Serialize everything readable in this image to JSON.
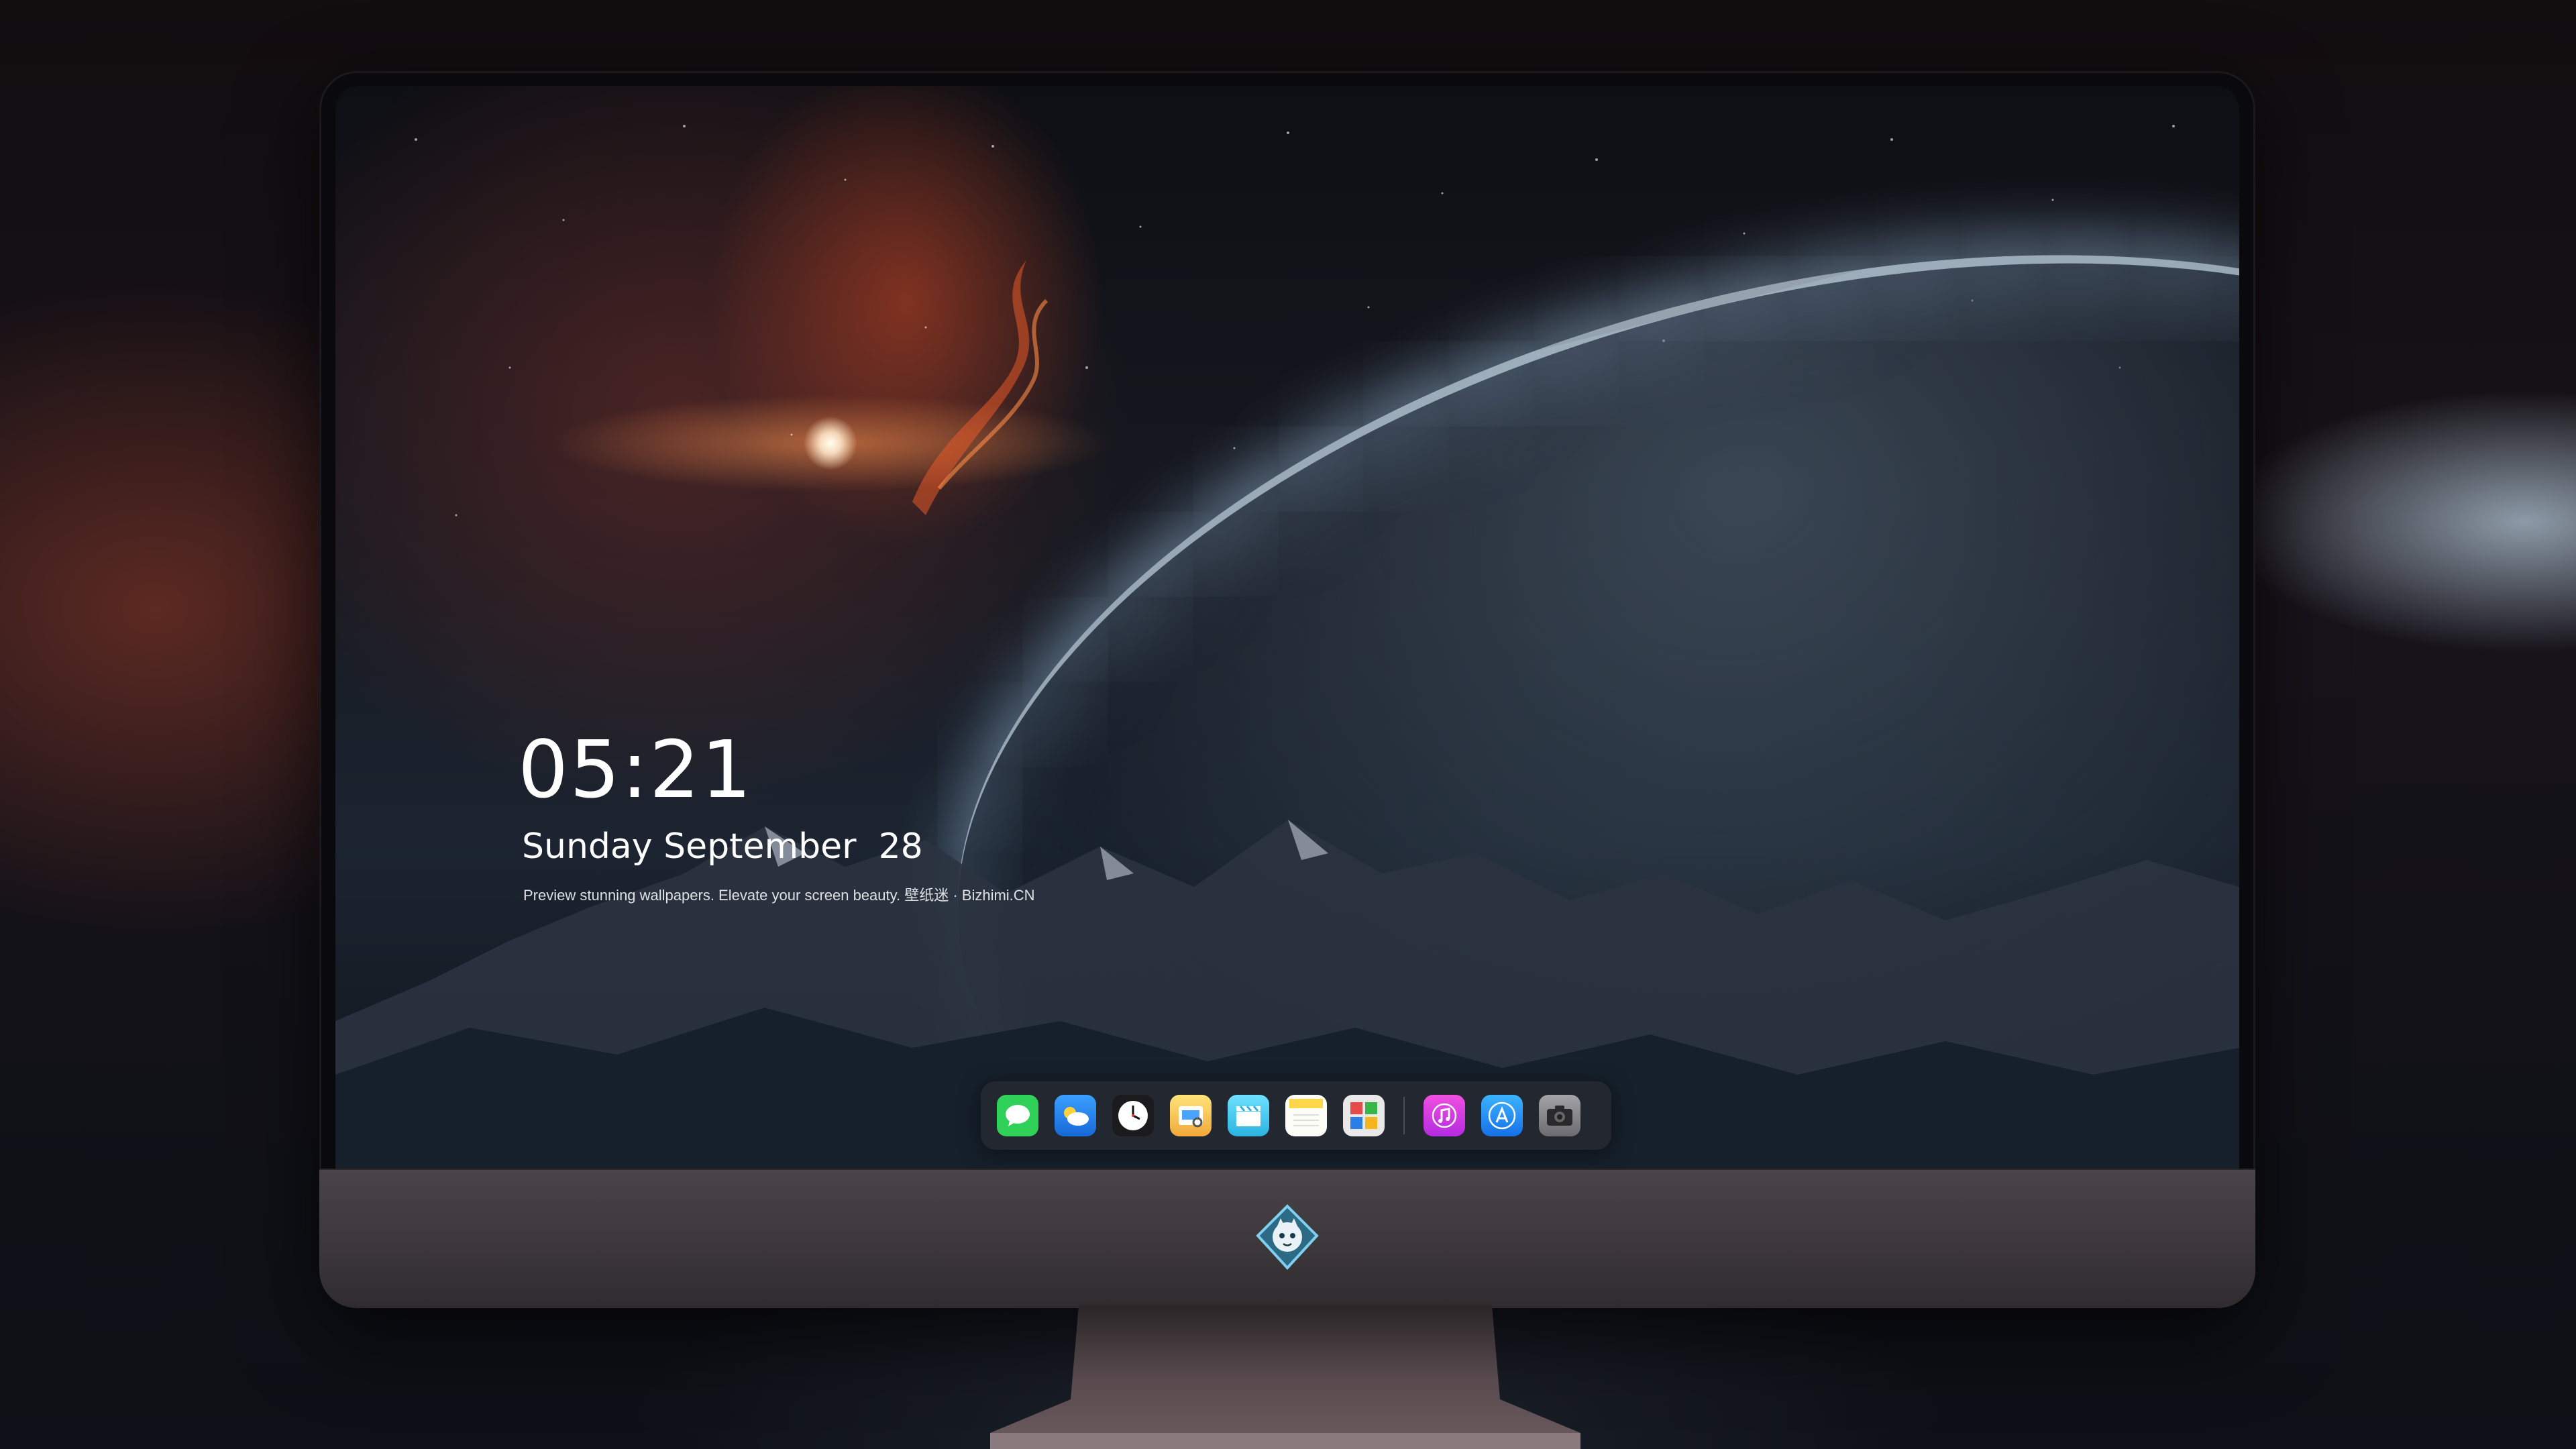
{
  "lock_screen": {
    "time": "05:21",
    "date": "Sunday September  28",
    "tagline": "Preview stunning wallpapers. Elevate your screen beauty. 壁纸迷 · Bizhimi.CN"
  },
  "dock": {
    "apps": [
      {
        "name": "messages-icon",
        "color": "#2fd158"
      },
      {
        "name": "weather-icon",
        "color": "#1e90ff"
      },
      {
        "name": "clock-icon",
        "color": "#1b1b1d"
      },
      {
        "name": "preview-icon",
        "color": "#f2c94c"
      },
      {
        "name": "clips-icon",
        "color": "#39c3e8"
      },
      {
        "name": "notes-icon",
        "color": "#ffd54a"
      },
      {
        "name": "photo-booth-icon",
        "color": "#e8e8e8"
      },
      {
        "name": "music-icon",
        "color": "#d43bdc"
      },
      {
        "name": "app-store-icon",
        "color": "#1c8cf5"
      },
      {
        "name": "camera-icon",
        "color": "#8e8e93"
      }
    ]
  },
  "colors": {
    "accent_red": "#c84628",
    "planet_glow": "#dcefff",
    "chin": "#4a4448"
  }
}
